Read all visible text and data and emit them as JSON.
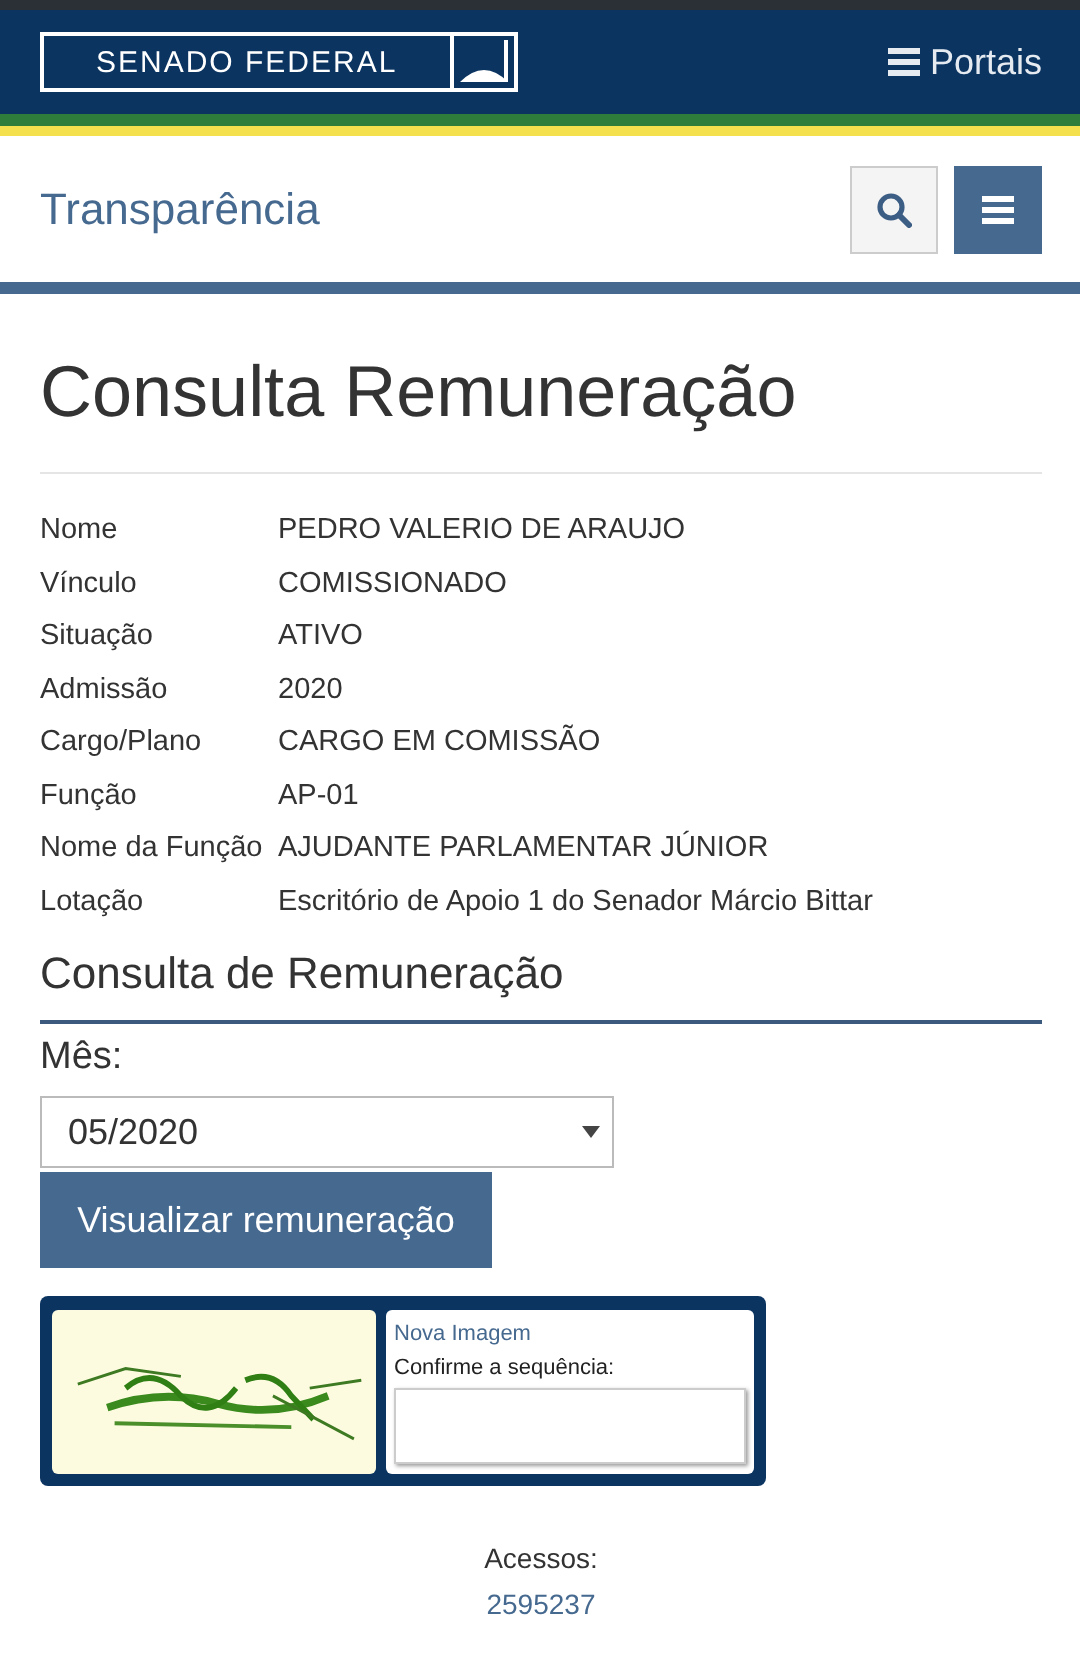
{
  "header": {
    "logo_text": "SENADO FEDERAL",
    "portals_label": "Portais"
  },
  "subheader": {
    "title": "Transparência"
  },
  "page_title": "Consulta Remuneração",
  "details": [
    {
      "label": "Nome",
      "value": "PEDRO VALERIO DE ARAUJO"
    },
    {
      "label": "Vínculo",
      "value": "COMISSIONADO"
    },
    {
      "label": "Situação",
      "value": "ATIVO"
    },
    {
      "label": "Admissão",
      "value": "2020"
    },
    {
      "label": "Cargo/Plano",
      "value": "CARGO EM COMISSÃO"
    },
    {
      "label": "Função",
      "value": "AP-01"
    },
    {
      "label": "Nome da Função",
      "value": "AJUDANTE PARLAMENTAR JÚNIOR"
    },
    {
      "label": "Lotação",
      "value": "Escritório de Apoio 1 do Senador Márcio Bittar"
    }
  ],
  "section_title": "Consulta de Remuneração",
  "month": {
    "label": "Mês:",
    "value": "05/2020"
  },
  "view_button": "Visualizar remuneração",
  "captcha": {
    "new_image_link": "Nova Imagem",
    "prompt": "Confirme a sequência:"
  },
  "footer": {
    "label": "Acessos:",
    "count": "2595237"
  }
}
